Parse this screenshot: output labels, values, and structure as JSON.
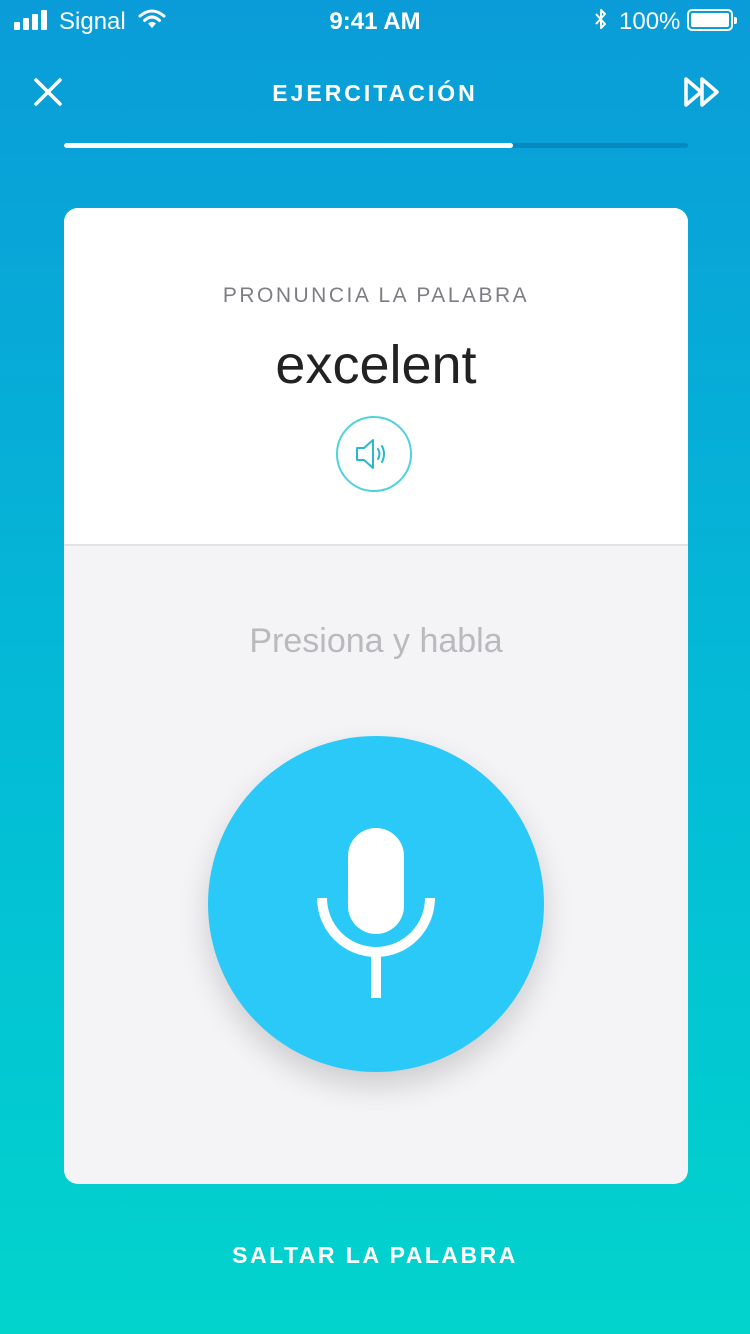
{
  "status_bar": {
    "carrier": "Signal",
    "time": "9:41 AM",
    "battery_percent": "100%",
    "icons": [
      "signal-bars-icon",
      "wifi-icon",
      "bluetooth-icon",
      "battery-icon"
    ]
  },
  "header": {
    "title": "EJERCITACIÓN",
    "progress": 0.72,
    "icons": [
      "close-icon",
      "fast-forward-icon"
    ]
  },
  "card": {
    "prompt": "PRONUNCIA LA PALABRA",
    "word": "excelent",
    "speaker_icon": "speaker-icon",
    "hint": "Presiona y habla",
    "mic_icon": "microphone-icon"
  },
  "footer": {
    "skip_label": "SALTAR LA PALABRA"
  },
  "colors": {
    "gradient_top": "#0a9cd8",
    "gradient_bottom": "#02d4cc",
    "mic_button": "#2ac9f7",
    "speaker_ring": "#4fd1de"
  }
}
